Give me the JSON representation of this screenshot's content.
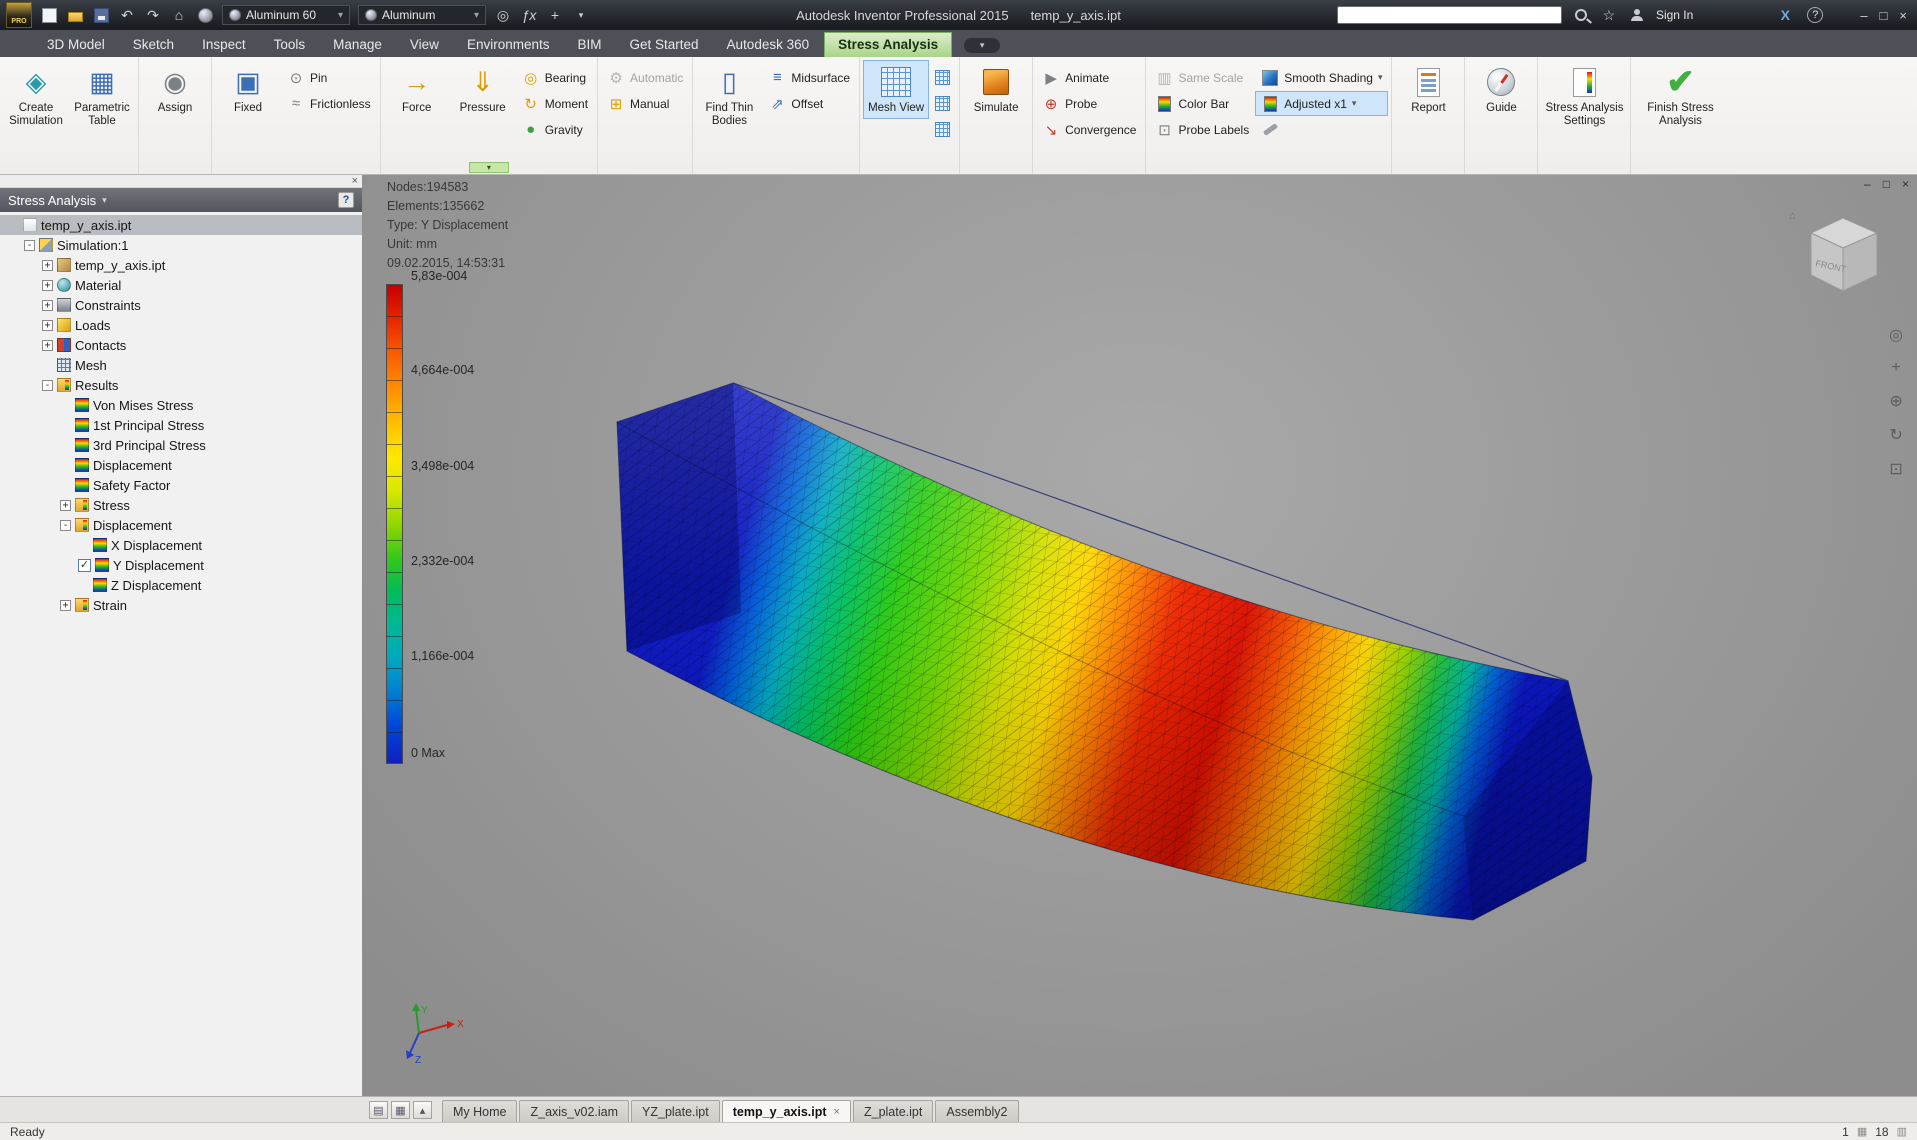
{
  "title_bar": {
    "logo_text": "PRO",
    "app_title": "Autodesk Inventor Professional 2015",
    "doc_title": "temp_y_axis.ipt",
    "material_combo": "Aluminum 60",
    "appearance_combo": "Aluminum",
    "sign_in_label": "Sign In",
    "search_value": ""
  },
  "tabs": [
    "3D Model",
    "Sketch",
    "Inspect",
    "Tools",
    "Manage",
    "View",
    "Environments",
    "BIM",
    "Get Started",
    "Autodesk 360",
    "Stress Analysis"
  ],
  "ribbon": {
    "create_simulation": "Create Simulation",
    "parametric_table": "Parametric Table",
    "assign": "Assign",
    "fixed": "Fixed",
    "pin": "Pin",
    "frictionless": "Frictionless",
    "force": "Force",
    "pressure": "Pressure",
    "bearing": "Bearing",
    "moment": "Moment",
    "gravity": "Gravity",
    "automatic": "Automatic",
    "manual": "Manual",
    "find_thin_bodies": "Find Thin Bodies",
    "midsurface": "Midsurface",
    "offset": "Offset",
    "mesh_view": "Mesh View",
    "simulate": "Simulate",
    "animate": "Animate",
    "probe": "Probe",
    "convergence": "Convergence",
    "same_scale": "Same Scale",
    "color_bar": "Color Bar",
    "probe_labels": "Probe Labels",
    "smooth_shading": "Smooth Shading",
    "adjusted": "Adjusted x1",
    "report": "Report",
    "guide": "Guide",
    "stress_settings": "Stress Analysis Settings",
    "finish": "Finish Stress Analysis"
  },
  "icons": {
    "caret": "▾",
    "caret_up": "▴",
    "undo": "↶",
    "redo": "↷",
    "home": "⌂",
    "star": "☆",
    "question": "?",
    "minimize": "–",
    "restore": "□",
    "close": "×",
    "x_logo": "X",
    "fx": "ƒx",
    "plus": "+",
    "create_simulation": "◈",
    "parametric_table": "▦",
    "assign": "◉",
    "fixed": "▣",
    "pin": "⊙",
    "frictionless": "≈",
    "force": "→",
    "pressure": "⇓",
    "bearing": "◎",
    "moment": "↻",
    "gravity": "●",
    "automatic": "⚙",
    "manual": "⊞",
    "find_thin_bodies": "▯",
    "midsurface": "≡",
    "offset": "⇗",
    "animate": "▶",
    "probe": "⊕",
    "convergence": "↘",
    "same_scale": "▥",
    "probe_labels": "⊡",
    "settings": "⚙",
    "finish": "✔",
    "nav_wheel": "◎",
    "nav_zoom": "⊕",
    "nav_orbit": "↻",
    "nav_pan": "+",
    "nav_look": "⊡",
    "status_icon1": "▦",
    "status_icon2": "▥",
    "panel_a": "▤",
    "panel_b": "▦"
  },
  "browser": {
    "header": "Stress Analysis",
    "items": [
      {
        "label": "temp_y_axis.ipt"
      },
      {
        "label": "Simulation:1",
        "exp": "-"
      },
      {
        "label": "temp_y_axis.ipt",
        "exp": "+"
      },
      {
        "label": "Material",
        "exp": "+"
      },
      {
        "label": "Constraints",
        "exp": "+"
      },
      {
        "label": "Loads",
        "exp": "+"
      },
      {
        "label": "Contacts",
        "exp": "+"
      },
      {
        "label": "Mesh"
      },
      {
        "label": "Results",
        "exp": "-"
      },
      {
        "label": "Von Mises Stress"
      },
      {
        "label": "1st Principal Stress"
      },
      {
        "label": "3rd Principal Stress"
      },
      {
        "label": "Displacement"
      },
      {
        "label": "Safety Factor"
      },
      {
        "label": "Stress",
        "exp": "+"
      },
      {
        "label": "Displacement",
        "exp": "-"
      },
      {
        "label": "X Displacement"
      },
      {
        "label": "Y Displacement",
        "check": "✓"
      },
      {
        "label": "Z Displacement"
      },
      {
        "label": "Strain",
        "exp": "+"
      }
    ]
  },
  "viewport": {
    "info_lines": [
      "Nodes:194583",
      "Elements:135662",
      "Type: Y Displacement",
      "Unit: mm",
      "09.02.2015, 14:53:31"
    ],
    "legend_labels": [
      "5,83e-004",
      "4,664e-004",
      "3,498e-004",
      "2,332e-004",
      "1,166e-004",
      "0 Max"
    ],
    "viewcube_front": "FRONT",
    "triad_x": "X",
    "triad_y": "Y",
    "triad_z": "Z"
  },
  "doc_tabs": [
    "My Home",
    "Z_axis_v02.iam",
    "YZ_plate.ipt",
    "temp_y_axis.ipt",
    "Z_plate.ipt",
    "Assembly2"
  ],
  "status": {
    "left": "Ready",
    "count1": "1",
    "count2": "18"
  },
  "colors": {
    "active_tab_green": "#a9d489",
    "selection_blue": "#cfe5fa",
    "legend_top_red": "#e00000",
    "legend_bottom_blue": "#1020c0",
    "simulate_orange": "#e2821e",
    "finish_green": "#3faf3f"
  }
}
